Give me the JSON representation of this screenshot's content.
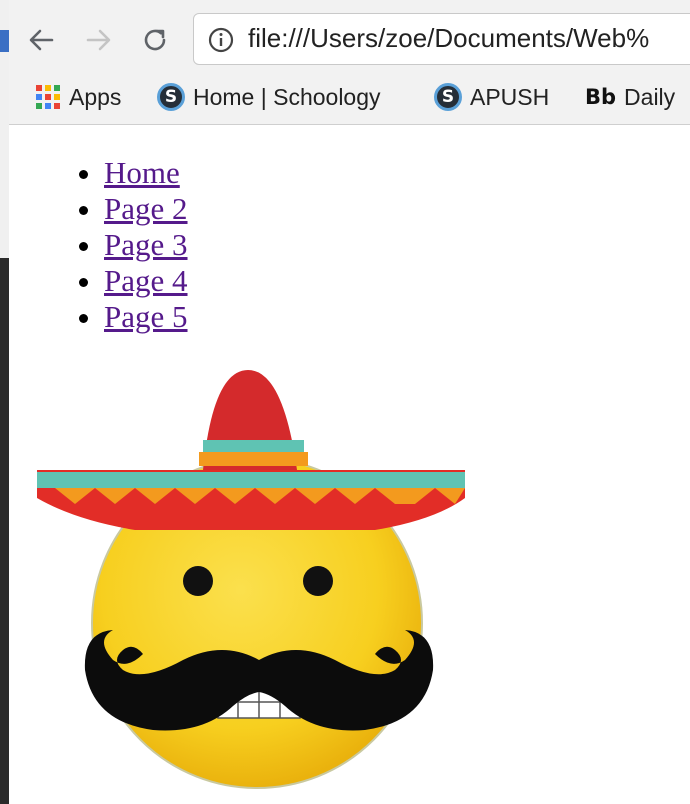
{
  "browser": {
    "url": "file:///Users/zoe/Documents/Web%"
  },
  "bookmarks": [
    {
      "label": "Apps",
      "icon": "apps-grid-icon"
    },
    {
      "label": "Home | Schoology",
      "icon": "schoology-icon"
    },
    {
      "label": "APUSH",
      "icon": "schoology-icon"
    },
    {
      "label": "Daily",
      "icon": "blackboard-icon",
      "icon_text": "Bb"
    }
  ],
  "nav_links": [
    {
      "label": "Home"
    },
    {
      "label": "Page 2"
    },
    {
      "label": "Page 3"
    },
    {
      "label": "Page 4"
    },
    {
      "label": "Page 5"
    }
  ],
  "image": {
    "icon": "sombrero-mustache-emoji-image"
  },
  "colors": {
    "link_visited": "#551a8b",
    "toolbar_bg": "#f2f2f2"
  }
}
